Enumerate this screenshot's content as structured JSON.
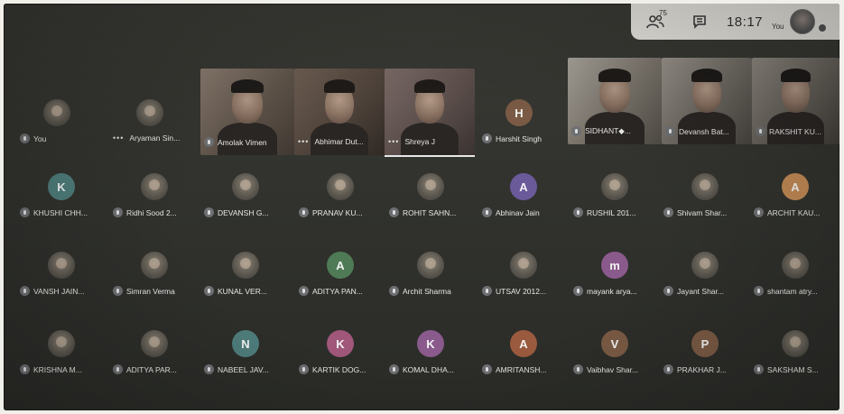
{
  "topbar": {
    "people_count": "75",
    "time": "18:17",
    "you_label": "You"
  },
  "colors": {
    "background": "#2f302c",
    "topbar": "#e9e7e1",
    "mic_badge": "#6d6f72",
    "avatar_colors": {
      "orange": "#c28a55",
      "purple": "#8a5a8c",
      "green": "#4f7a56",
      "brown": "#7a5a44",
      "teal": "#4e7d7b",
      "violet": "#6a5a9a",
      "pink": "#a0577a",
      "rust": "#9a5a3e"
    }
  },
  "participants": [
    {
      "name": "You",
      "initial": "",
      "avatar": "photo",
      "video": false
    },
    {
      "name": "Aryaman Sin...",
      "initial": "",
      "avatar": "photo",
      "video": false,
      "more": true
    },
    {
      "name": "Amolak Vimen",
      "initial": "",
      "avatar": "",
      "video": true
    },
    {
      "name": "Abhimar Dut...",
      "initial": "",
      "avatar": "",
      "video": true,
      "more": true
    },
    {
      "name": "Shreya J",
      "initial": "",
      "avatar": "",
      "video": true,
      "more": true
    },
    {
      "name": "Harshit Singh",
      "initial": "H",
      "avatar": "brown",
      "video": false
    },
    {
      "name": "SIDHANT◆...",
      "initial": "",
      "avatar": "",
      "video": true
    },
    {
      "name": "Devansh Bat...",
      "initial": "",
      "avatar": "",
      "video": true
    },
    {
      "name": "RAKSHIT KU...",
      "initial": "",
      "avatar": "",
      "video": true
    },
    {
      "name": "KHUSHI CHH...",
      "initial": "K",
      "avatar": "teal",
      "video": false
    },
    {
      "name": "Ridhi Sood 2...",
      "initial": "",
      "avatar": "photo",
      "video": false
    },
    {
      "name": "DEVANSH G...",
      "initial": "",
      "avatar": "photo",
      "video": false
    },
    {
      "name": "PRANAV KU...",
      "initial": "",
      "avatar": "photo",
      "video": false
    },
    {
      "name": "ROHIT SAHN...",
      "initial": "",
      "avatar": "photo",
      "video": false
    },
    {
      "name": "Abhinav Jain",
      "initial": "A",
      "avatar": "violet",
      "video": false
    },
    {
      "name": "RUSHIL 201...",
      "initial": "",
      "avatar": "photo",
      "video": false
    },
    {
      "name": "Shivam Shar...",
      "initial": "",
      "avatar": "photo",
      "video": false
    },
    {
      "name": "ARCHIT KAU...",
      "initial": "A",
      "avatar": "orange",
      "video": false
    },
    {
      "name": "VANSH JAIN...",
      "initial": "",
      "avatar": "photo",
      "video": false
    },
    {
      "name": "Simran Verma",
      "initial": "",
      "avatar": "photo",
      "video": false
    },
    {
      "name": "KUNAL VER...",
      "initial": "",
      "avatar": "photo",
      "video": false
    },
    {
      "name": "ADITYA PAN...",
      "initial": "A",
      "avatar": "green",
      "video": false
    },
    {
      "name": "Archit Sharma",
      "initial": "",
      "avatar": "photo",
      "video": false
    },
    {
      "name": "UTSAV 2012...",
      "initial": "",
      "avatar": "photo",
      "video": false
    },
    {
      "name": "mayank arya...",
      "initial": "m",
      "avatar": "purple",
      "video": false
    },
    {
      "name": "Jayant Shar...",
      "initial": "",
      "avatar": "photo",
      "video": false
    },
    {
      "name": "shantam atry...",
      "initial": "",
      "avatar": "photo",
      "video": false
    },
    {
      "name": "KRISHNA M...",
      "initial": "",
      "avatar": "photo",
      "video": false
    },
    {
      "name": "ADITYA PAR...",
      "initial": "",
      "avatar": "photo",
      "video": false
    },
    {
      "name": "NABEEL JAV...",
      "initial": "N",
      "avatar": "teal",
      "video": false
    },
    {
      "name": "KARTIK DOG...",
      "initial": "K",
      "avatar": "pink",
      "video": false
    },
    {
      "name": "KOMAL DHA...",
      "initial": "K",
      "avatar": "purple",
      "video": false
    },
    {
      "name": "AMRITANSH...",
      "initial": "A",
      "avatar": "rust",
      "video": false
    },
    {
      "name": "Vaibhav Shar...",
      "initial": "V",
      "avatar": "brown",
      "video": false
    },
    {
      "name": "PRAKHAR J...",
      "initial": "P",
      "avatar": "brown",
      "video": false
    },
    {
      "name": "SAKSHAM S...",
      "initial": "",
      "avatar": "photo",
      "video": false
    }
  ]
}
